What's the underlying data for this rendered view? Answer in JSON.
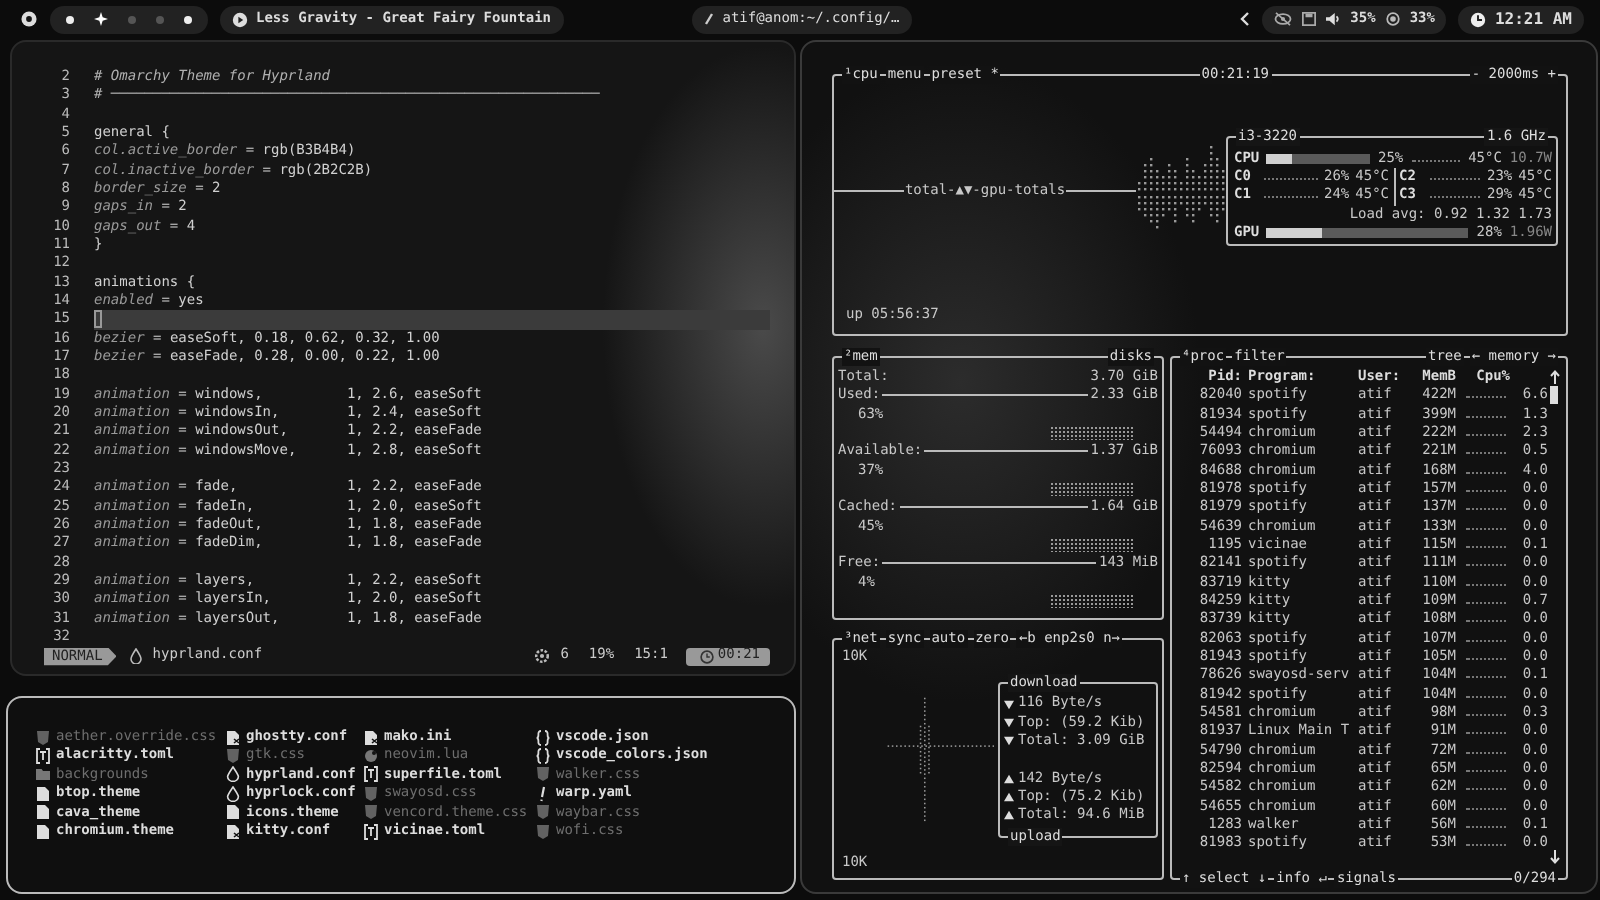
{
  "top_bar": {
    "workspaces": [
      {
        "selected": false,
        "occupied": true
      },
      {
        "selected": true,
        "occupied": true
      },
      {
        "selected": false,
        "occupied": false
      },
      {
        "selected": false,
        "occupied": false
      },
      {
        "selected": false,
        "occupied": true
      }
    ],
    "media_title": "Less Gravity - Great Fairy Fountain",
    "window_title": "atif@anom:~/.config/…",
    "volume": "35%",
    "brightness": "33%",
    "clock": "12:21 AM"
  },
  "editor": {
    "lines": [
      {
        "n": "2",
        "kind": "comment",
        "text": "# Omarchy Theme for Hyprland",
        "current": false
      },
      {
        "n": "3",
        "kind": "comment",
        "text": "# ──────────────────────────────────────────────────────────",
        "current": false
      },
      {
        "n": "4",
        "current": false
      },
      {
        "n": "5",
        "kind": "code",
        "text": "general {",
        "current": false
      },
      {
        "n": "6",
        "kind": "code",
        "text": "    *col.active_border* = rgb(B3B4B4)",
        "current": false
      },
      {
        "n": "7",
        "kind": "code",
        "text": "    *col.inactive_border* = rgb(2B2C2B)",
        "current": false
      },
      {
        "n": "8",
        "kind": "code",
        "text": "    *border_size* = 2",
        "current": false
      },
      {
        "n": "9",
        "kind": "code",
        "text": "    *gaps_in* = 2",
        "current": false
      },
      {
        "n": "10",
        "kind": "code",
        "text": "    *gaps_out* = 4",
        "current": false
      },
      {
        "n": "11",
        "kind": "code",
        "text": "}",
        "current": false
      },
      {
        "n": "12",
        "current": false
      },
      {
        "n": "13",
        "kind": "code",
        "text": "animations {",
        "current": false
      },
      {
        "n": "14",
        "kind": "code",
        "text": "    *enabled* = yes",
        "current": false
      },
      {
        "n": "15",
        "current": true
      },
      {
        "n": "16",
        "kind": "code",
        "text": "    *bezier* = easeSoft, 0.18, 0.62, 0.32, 1.00",
        "current": false
      },
      {
        "n": "17",
        "kind": "code",
        "text": "    *bezier* = easeFade, 0.28, 0.00, 0.22, 1.00",
        "current": false
      },
      {
        "n": "18",
        "current": false
      },
      {
        "n": "19",
        "kind": "code",
        "text": "    *animation* = windows,          1, 2.6, easeSoft",
        "current": false
      },
      {
        "n": "20",
        "kind": "code",
        "text": "    *animation* = windowsIn,        1, 2.4, easeSoft",
        "current": false
      },
      {
        "n": "21",
        "kind": "code",
        "text": "    *animation* = windowsOut,       1, 2.2, easeFade",
        "current": false
      },
      {
        "n": "22",
        "kind": "code",
        "text": "    *animation* = windowsMove,      1, 2.8, easeSoft",
        "current": false
      },
      {
        "n": "23",
        "current": false
      },
      {
        "n": "24",
        "kind": "code",
        "text": "    *animation* = fade,             1, 2.2, easeFade",
        "current": false
      },
      {
        "n": "25",
        "kind": "code",
        "text": "    *animation* = fadeIn,           1, 2.0, easeSoft",
        "current": false
      },
      {
        "n": "26",
        "kind": "code",
        "text": "    *animation* = fadeOut,          1, 1.8, easeFade",
        "current": false
      },
      {
        "n": "27",
        "kind": "code",
        "text": "    *animation* = fadeDim,          1, 1.8, easeFade",
        "current": false
      },
      {
        "n": "28",
        "current": false
      },
      {
        "n": "29",
        "kind": "code",
        "text": "    *animation* = layers,           1, 2.2, easeSoft",
        "current": false
      },
      {
        "n": "30",
        "kind": "code",
        "text": "    *animation* = layersIn,         1, 2.0, easeSoft",
        "current": false
      },
      {
        "n": "31",
        "kind": "code",
        "text": "    *animation* = layersOut,        1, 1.8, easeFade",
        "current": false
      },
      {
        "n": "32",
        "current": false
      }
    ],
    "status": {
      "mode": "NORMAL",
      "file": "hyprland.conf",
      "diagnostics": "6",
      "percent": "19%",
      "position": "15:1",
      "time": "00:21"
    }
  },
  "file_list": {
    "columns": [
      [
        {
          "name": "aether.override.css",
          "kind": "css",
          "dimmed": true
        },
        {
          "name": "alacritty.toml",
          "kind": "toml",
          "dimmed": false
        },
        {
          "name": "backgrounds",
          "kind": "folder",
          "dimmed": true
        },
        {
          "name": "btop.theme",
          "kind": "file",
          "dimmed": false
        },
        {
          "name": "cava_theme",
          "kind": "file",
          "dimmed": false
        },
        {
          "name": "chromium.theme",
          "kind": "file",
          "dimmed": false
        }
      ],
      [
        {
          "name": "ghostty.conf",
          "kind": "conf",
          "dimmed": false
        },
        {
          "name": "gtk.css",
          "kind": "css",
          "dimmed": true
        },
        {
          "name": "hyprland.conf",
          "kind": "drop",
          "dimmed": false
        },
        {
          "name": "hyprlock.conf",
          "kind": "drop",
          "dimmed": false
        },
        {
          "name": "icons.theme",
          "kind": "file",
          "dimmed": false
        },
        {
          "name": "kitty.conf",
          "kind": "conf",
          "dimmed": false
        }
      ],
      [
        {
          "name": "mako.ini",
          "kind": "conf",
          "dimmed": false
        },
        {
          "name": "neovim.lua",
          "kind": "lua",
          "dimmed": true
        },
        {
          "name": "superfile.toml",
          "kind": "toml",
          "dimmed": false
        },
        {
          "name": "swayosd.css",
          "kind": "css",
          "dimmed": true
        },
        {
          "name": "vencord.theme.css",
          "kind": "css",
          "dimmed": true
        },
        {
          "name": "vicinae.toml",
          "kind": "toml",
          "dimmed": false
        }
      ],
      [
        {
          "name": "vscode.json",
          "kind": "json",
          "dimmed": false
        },
        {
          "name": "vscode_colors.json",
          "kind": "json",
          "dimmed": false
        },
        {
          "name": "walker.css",
          "kind": "css",
          "dimmed": true
        },
        {
          "name": "warp.yaml",
          "kind": "yaml",
          "dimmed": false
        },
        {
          "name": "waybar.css",
          "kind": "css",
          "dimmed": true
        },
        {
          "name": "wofi.css",
          "kind": "css",
          "dimmed": true
        }
      ]
    ]
  },
  "btop": {
    "cpu": {
      "tabs": [
        "¹cpu",
        "menu",
        "preset *"
      ],
      "clock": "00:21:19",
      "interval": "- 2000ms +",
      "graph_label": "total-▲▼-gpu-totals",
      "model": "i3-3220",
      "freq": "1.6 GHz",
      "cpu": {
        "label": "CPU",
        "level": 0.25,
        "percent": "25%",
        "temp": "45°C",
        "power": "10.7W"
      },
      "cores": [
        {
          "label": "C0",
          "percent": "26%",
          "temp": "45°C"
        },
        {
          "label": "C2",
          "percent": "23%",
          "temp": "45°C"
        },
        {
          "label": "C1",
          "percent": "24%",
          "temp": "45°C"
        },
        {
          "label": "C3",
          "percent": "29%",
          "temp": "45°C"
        }
      ],
      "load": "Load avg: 0.92 1.32 1.73",
      "gpu": {
        "label": "GPU",
        "level": 0.28,
        "percent": "28%",
        "power": "1.96W"
      },
      "uptime": "up 05:56:37"
    },
    "mem": {
      "title": "²mem",
      "disks": "disks",
      "rows": [
        {
          "label": "Total:",
          "value": "3.70 GiB"
        },
        {
          "label": "Used:",
          "value": "2.33 GiB",
          "percent": "63%"
        },
        {
          "label": "Available:",
          "value": "1.37 GiB",
          "percent": "37%"
        },
        {
          "label": "Cached:",
          "value": "1.64 GiB",
          "percent": "45%"
        },
        {
          "label": "Free:",
          "value": "143 MiB",
          "percent": "4%"
        }
      ]
    },
    "net": {
      "tabs": [
        "³net",
        "sync",
        "auto",
        "zero",
        "←b enp2s0 n→"
      ],
      "scale_top": "10K",
      "scale_bottom": "10K",
      "download_label": "download",
      "upload_label": "upload",
      "download": [
        "116 Byte/s",
        "Top: (59.2 Kib)",
        "Total: 3.09 GiB"
      ],
      "upload": [
        "142 Byte/s",
        "Top: (75.2 Kib)",
        "Total: 94.6 MiB"
      ]
    },
    "proc": {
      "tabs": [
        "⁴proc",
        "filter"
      ],
      "tree": "tree",
      "sort": "← memory →",
      "columns": [
        "Pid:",
        "Program:",
        "User:",
        "MemB",
        "Cpu%"
      ],
      "rows": [
        [
          "82040",
          "spotify",
          "atif",
          "422M",
          "6.6"
        ],
        [
          "81934",
          "spotify",
          "atif",
          "399M",
          "1.3"
        ],
        [
          "54494",
          "chromium",
          "atif",
          "222M",
          "2.3"
        ],
        [
          "76093",
          "chromium",
          "atif",
          "221M",
          "0.5"
        ],
        [
          "84688",
          "chromium",
          "atif",
          "168M",
          "4.0"
        ],
        [
          "81978",
          "spotify",
          "atif",
          "157M",
          "0.0"
        ],
        [
          "81979",
          "spotify",
          "atif",
          "137M",
          "0.0"
        ],
        [
          "54639",
          "chromium",
          "atif",
          "133M",
          "0.0"
        ],
        [
          "1195",
          "vicinae",
          "atif",
          "115M",
          "0.1"
        ],
        [
          "82141",
          "spotify",
          "atif",
          "111M",
          "0.0"
        ],
        [
          "83719",
          "kitty",
          "atif",
          "110M",
          "0.0"
        ],
        [
          "84259",
          "kitty",
          "atif",
          "109M",
          "0.7"
        ],
        [
          "83739",
          "kitty",
          "atif",
          "108M",
          "0.0"
        ],
        [
          "82063",
          "spotify",
          "atif",
          "107M",
          "0.0"
        ],
        [
          "81943",
          "spotify",
          "atif",
          "105M",
          "0.0"
        ],
        [
          "78626",
          "swayosd-serv",
          "atif",
          "104M",
          "0.1"
        ],
        [
          "81942",
          "spotify",
          "atif",
          "104M",
          "0.0"
        ],
        [
          "54581",
          "chromium",
          "atif",
          "98M",
          "0.3"
        ],
        [
          "81937",
          "Linux Main T",
          "atif",
          "91M",
          "0.0"
        ],
        [
          "54790",
          "chromium",
          "atif",
          "72M",
          "0.0"
        ],
        [
          "82594",
          "chromium",
          "atif",
          "65M",
          "0.0"
        ],
        [
          "54582",
          "chromium",
          "atif",
          "62M",
          "0.0"
        ],
        [
          "54655",
          "chromium",
          "atif",
          "60M",
          "0.0"
        ],
        [
          "1283",
          "walker",
          "atif",
          "56M",
          "0.1"
        ],
        [
          "81983",
          "spotify",
          "atif",
          "53M",
          "0.0"
        ]
      ],
      "footer": [
        "↑ select ↓",
        "info ↵",
        "signals"
      ],
      "count": "0/294"
    }
  }
}
